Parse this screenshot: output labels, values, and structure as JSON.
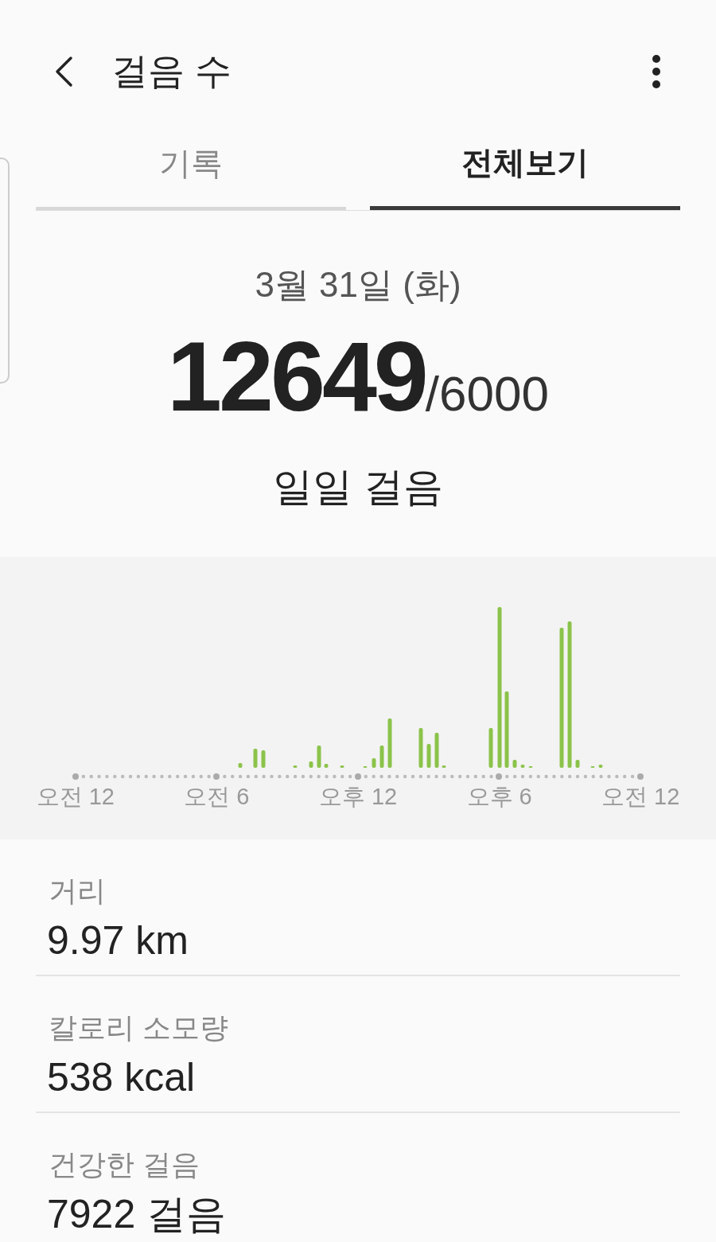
{
  "header": {
    "title": "걸음 수"
  },
  "tabs": [
    {
      "label": "기록",
      "selected": false
    },
    {
      "label": "전체보기",
      "selected": true
    }
  ],
  "summary": {
    "date": "3월 31일 (화)",
    "steps": "12649",
    "goal": "/6000",
    "caption": "일일 걸음"
  },
  "chart": {
    "axis_labels": [
      "오전 12",
      "오전 6",
      "오후 12",
      "오후 6",
      "오전 12"
    ]
  },
  "stats": [
    {
      "label": "거리",
      "value": "9.97 km"
    },
    {
      "label": "칼로리 소모량",
      "value": "538 kcal"
    },
    {
      "label": "건강한 걸음",
      "value": "7922 걸음"
    }
  ]
}
